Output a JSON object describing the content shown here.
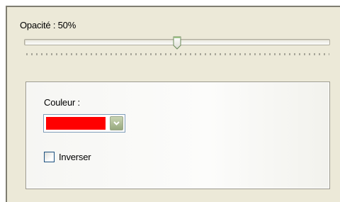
{
  "opacity": {
    "label": "Opacité : 50%",
    "value_percent": 50
  },
  "color": {
    "label": "Couleur :",
    "value": "#ff0000",
    "dropdown_icon": "chevron-down-icon"
  },
  "invert": {
    "label": "Inverser",
    "checked": false
  }
}
